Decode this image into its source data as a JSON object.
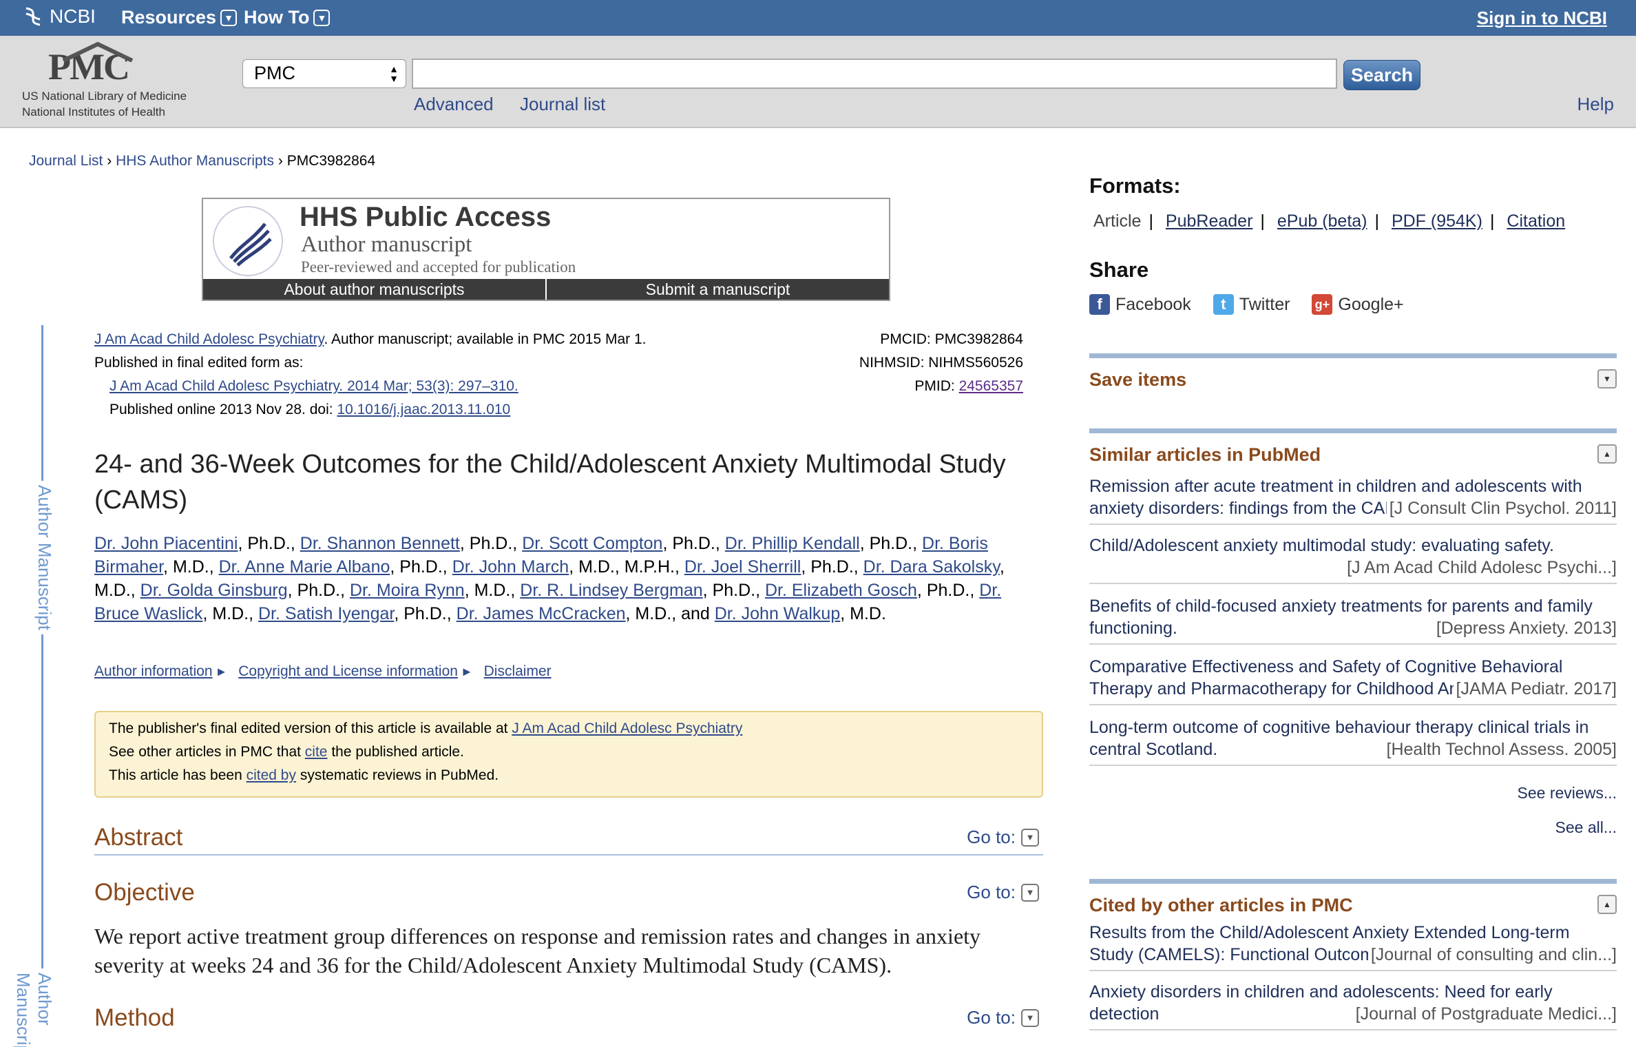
{
  "topbar": {
    "ncbi": "NCBI",
    "resources": "Resources",
    "howto": "How To",
    "signin": "Sign in to NCBI"
  },
  "header": {
    "logo": "PMC",
    "logo_line1": "US National Library of Medicine",
    "logo_line2": "National Institutes of Health",
    "db_selected": "PMC",
    "search_value": "",
    "search_button": "Search",
    "advanced": "Advanced",
    "journal_list": "Journal list",
    "help": "Help"
  },
  "breadcrumb": {
    "items": [
      "Journal List",
      "HHS Author Manuscripts",
      "PMC3982864"
    ],
    "separator": "›"
  },
  "hhs_banner": {
    "title": "HHS Public Access",
    "subtitle": "Author manuscript",
    "tagline": "Peer-reviewed and accepted for publication",
    "about": "About author manuscripts",
    "submit": "Submit a manuscript"
  },
  "side_label": "Author Manuscript",
  "citation": {
    "journal_link": "J Am Acad Child Adolesc Psychiatry",
    "availability": ". Author manuscript; available in PMC 2015 Mar 1.",
    "published_label": "Published in final edited form as:",
    "final_form_link": "J Am Acad Child Adolesc Psychiatry. 2014 Mar; 53(3): 297–310.",
    "published_online": "Published online 2013 Nov 28. doi: ",
    "doi": "10.1016/j.jaac.2013.11.010",
    "pmcid": "PMCID: PMC3982864",
    "nihmsid": "NIHMSID: NIHMS560526",
    "pmid_label": "PMID: ",
    "pmid": "24565357"
  },
  "article": {
    "title": "24- and 36-Week Outcomes for the Child/Adolescent Anxiety Multimodal Study (CAMS)",
    "authors": [
      {
        "name": "Dr. John Piacentini",
        "suffix": ", Ph.D., "
      },
      {
        "name": "Dr. Shannon Bennett",
        "suffix": ", Ph.D., "
      },
      {
        "name": "Dr. Scott Compton",
        "suffix": ", Ph.D., "
      },
      {
        "name": "Dr. Phillip Kendall",
        "suffix": ", Ph.D., "
      },
      {
        "name": "Dr. Boris Birmaher",
        "suffix": ", M.D., "
      },
      {
        "name": "Dr. Anne Marie Albano",
        "suffix": ", Ph.D., "
      },
      {
        "name": "Dr. John March",
        "suffix": ", M.D., M.P.H., "
      },
      {
        "name": "Dr. Joel Sherrill",
        "suffix": ", Ph.D., "
      },
      {
        "name": "Dr. Dara Sakolsky",
        "suffix": ", M.D., "
      },
      {
        "name": "Dr. Golda Ginsburg",
        "suffix": ", Ph.D., "
      },
      {
        "name": "Dr. Moira Rynn",
        "suffix": ", M.D., "
      },
      {
        "name": "Dr. R. Lindsey Bergman",
        "suffix": ", Ph.D., "
      },
      {
        "name": "Dr. Elizabeth Gosch",
        "suffix": ", Ph.D., "
      },
      {
        "name": "Dr. Bruce Waslick",
        "suffix": ", M.D., "
      },
      {
        "name": "Dr. Satish Iyengar",
        "suffix": ", Ph.D., "
      },
      {
        "name": "Dr. James McCracken",
        "suffix": ", M.D., and "
      },
      {
        "name": "Dr. John Walkup",
        "suffix": ", M.D."
      }
    ],
    "author_info": "Author information",
    "copyright": "Copyright and License information",
    "disclaimer": "Disclaimer",
    "arrow": "►"
  },
  "notice": {
    "line1_pre": "The publisher's final edited version of this article is available at ",
    "line1_link": "J Am Acad Child Adolesc Psychiatry",
    "line2_pre": "See other articles in PMC that ",
    "line2_link": "cite",
    "line2_post": " the published article.",
    "line3_pre": "This article has been ",
    "line3_link": "cited by",
    "line3_post": " systematic reviews in PubMed."
  },
  "sections": {
    "goto": "Go to:",
    "abstract": "Abstract",
    "objective": "Objective",
    "objective_text": "We report active treatment group differences on response and remission rates and changes in anxiety severity at weeks 24 and 36 for the Child/Adolescent Anxiety Multimodal Study (CAMS).",
    "method": "Method"
  },
  "right": {
    "formats_title": "Formats:",
    "formats": {
      "current": "Article",
      "pubreader": "PubReader",
      "epub": "ePub (beta)",
      "pdf": "PDF (954K)",
      "citation": "Citation",
      "sep": "|"
    },
    "share_title": "Share",
    "share": {
      "facebook": "Facebook",
      "twitter": "Twitter",
      "google": "Google+"
    },
    "save_items": "Save items",
    "similar_title": "Similar articles in PubMed",
    "similar": [
      {
        "l1": "Remission after acute treatment in children and adolescents with",
        "l2": "anxiety disorders: findings from the CAMS.",
        "j": "[J Consult Clin Psychol. 2011]"
      },
      {
        "l1": "Child/Adolescent anxiety multimodal study: evaluating safety.",
        "l2": "",
        "j": "[J Am Acad Child Adolesc Psychi...]"
      },
      {
        "l1": "Benefits of child-focused anxiety treatments for parents and family",
        "l2": "functioning.",
        "j": "[Depress Anxiety. 2013]"
      },
      {
        "l1": "Comparative Effectiveness and Safety of Cognitive Behavioral",
        "l2": "Therapy and Pharmacotherapy for Childhood Anxiety Disorders",
        "j": "[JAMA Pediatr. 2017]"
      },
      {
        "l1": "Long-term outcome of cognitive behaviour therapy clinical trials in",
        "l2": "central Scotland.",
        "j": "[Health Technol Assess. 2005]"
      }
    ],
    "see_reviews": "See reviews...",
    "see_all": "See all...",
    "cited_title": "Cited by other articles in PMC",
    "cited": [
      {
        "l1": "Results from the Child/Adolescent Anxiety Extended Long-term",
        "l2": "Study (CAMELS): Functional Outcomes",
        "j": "[Journal of consulting and clin...]"
      },
      {
        "l1": "Anxiety disorders in children and adolescents: Need for early",
        "l2": "detection",
        "j": "[Journal of Postgraduate Medici...]"
      }
    ]
  },
  "colors": {
    "topbar": "#3f6a9e",
    "link": "#2f4a8a",
    "section_heading": "#8a4a1c",
    "notice_bg": "#fcf3d4"
  }
}
